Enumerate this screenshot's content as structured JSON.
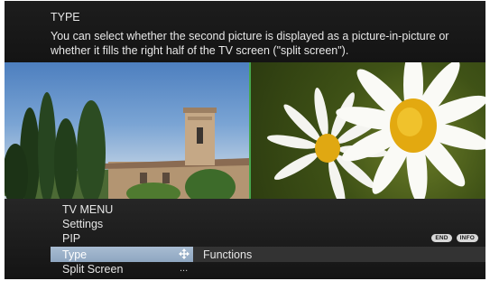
{
  "help": {
    "title": "TYPE",
    "text": "You can select whether the second picture is displayed as a picture-in-picture or whether it fills the right half of the TV screen (\"split screen\")."
  },
  "menu": {
    "breadcrumb": [
      "TV MENU",
      "Settings",
      "PIP"
    ],
    "items": [
      {
        "label": "Type",
        "selected": true,
        "value": "Functions"
      },
      {
        "label": "Split Screen",
        "selected": false,
        "value": "..."
      }
    ],
    "badges": [
      "END",
      "INFO"
    ]
  },
  "colors": {
    "highlight": "#9bb1c9",
    "pip_border": "#46a84e",
    "background": "#151515"
  },
  "icons": [
    "move-icon"
  ]
}
